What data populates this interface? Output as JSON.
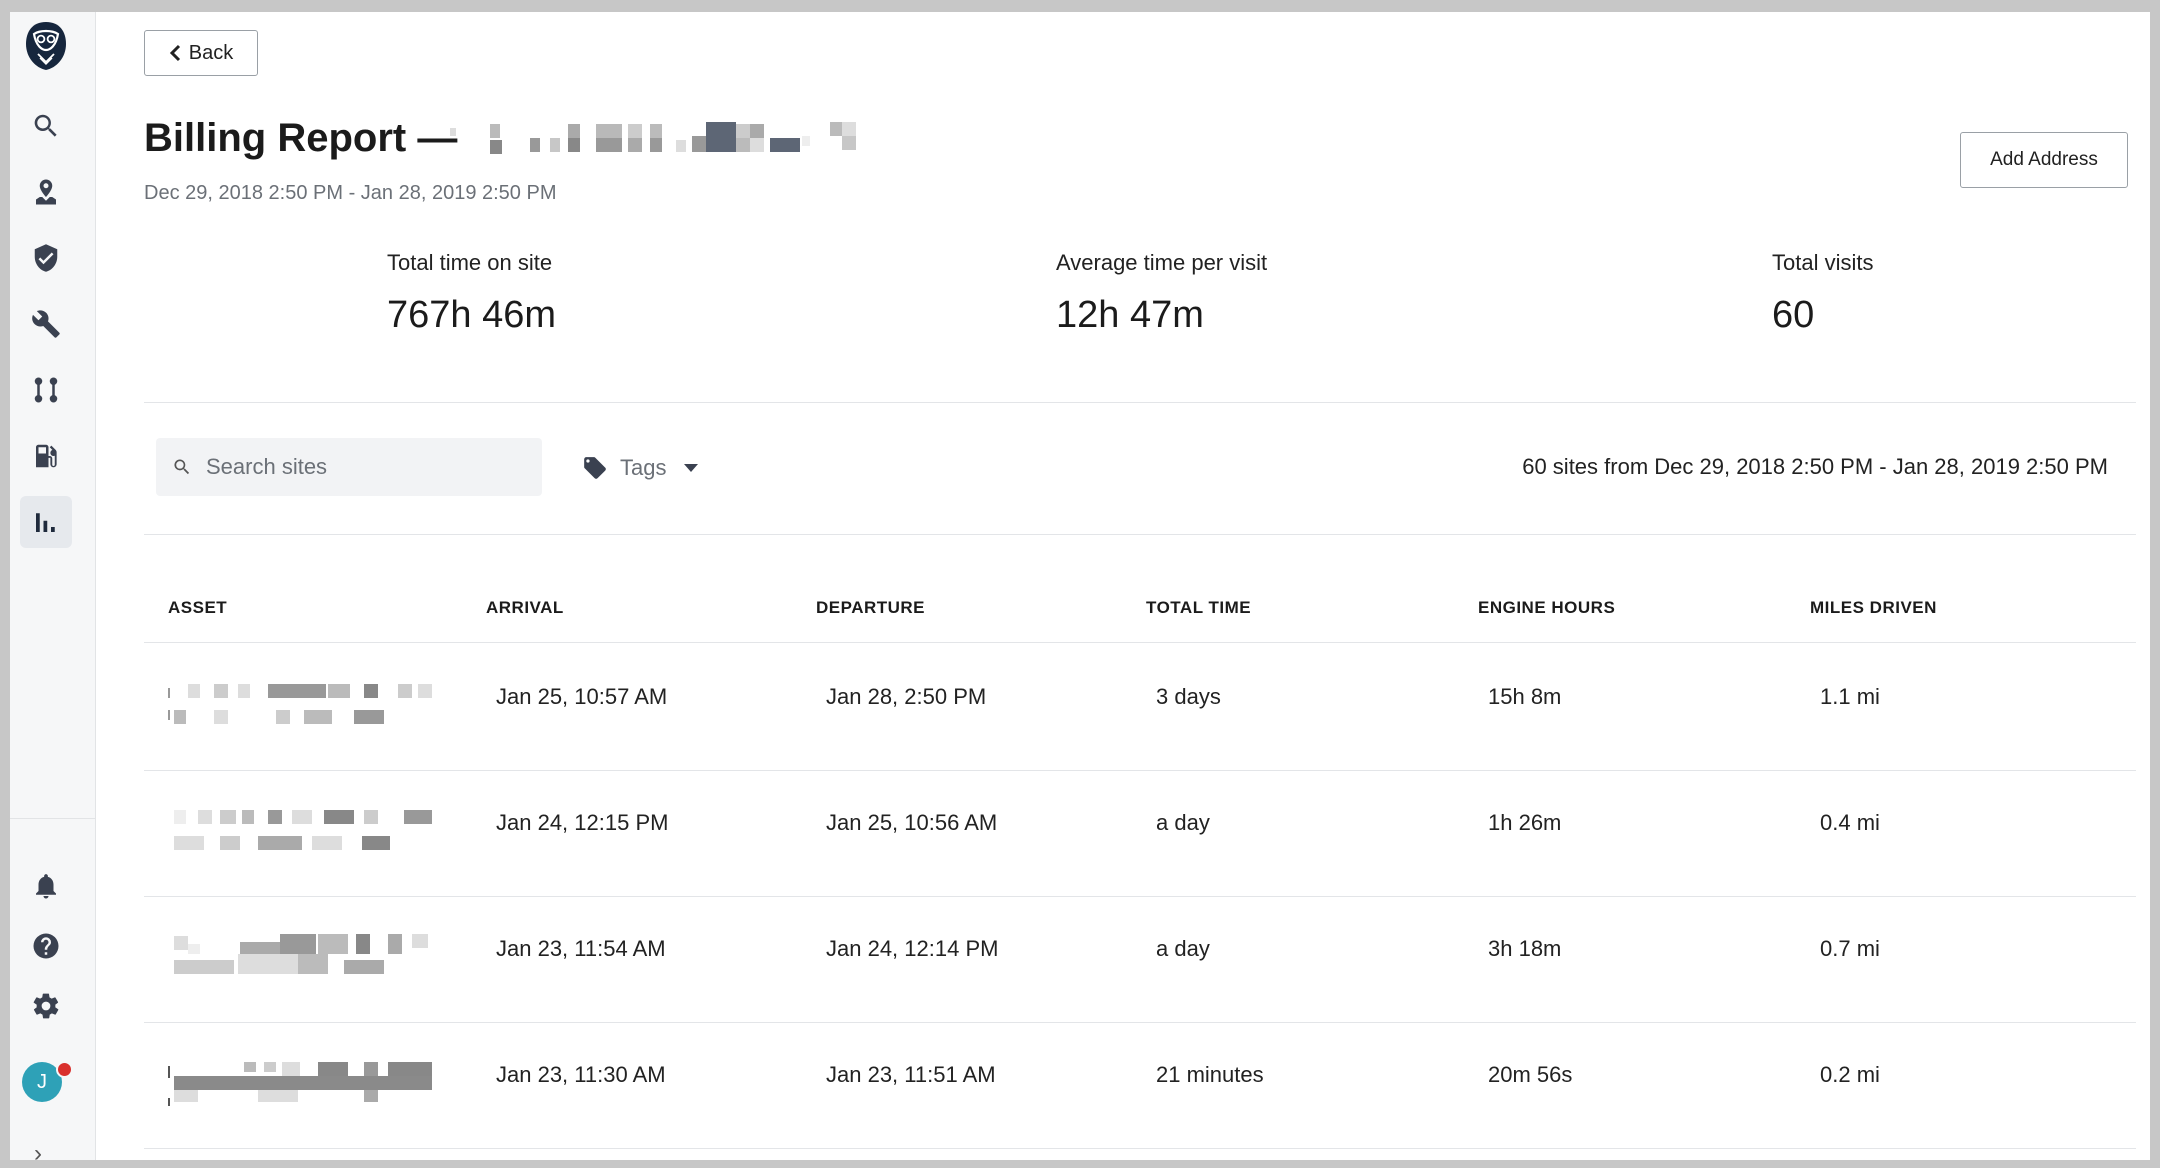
{
  "sidebar": {
    "items": [
      {
        "icon": "search-icon"
      },
      {
        "icon": "map-pin-icon"
      },
      {
        "icon": "shield-icon"
      },
      {
        "icon": "wrench-icon"
      },
      {
        "icon": "route-icon"
      },
      {
        "icon": "fuel-icon"
      },
      {
        "icon": "bar-chart-icon",
        "active": true
      }
    ],
    "bottom": [
      {
        "icon": "bell-icon"
      },
      {
        "icon": "help-icon"
      },
      {
        "icon": "gear-icon"
      }
    ],
    "avatar_initial": "J",
    "expand_glyph": "›"
  },
  "header": {
    "back_label": "Back",
    "title": "Billing Report —",
    "date_range": "Dec 29, 2018 2:50 PM - Jan 28, 2019 2:50 PM",
    "add_address_label": "Add Address"
  },
  "stats": [
    {
      "label": "Total time on site",
      "value": "767h 46m"
    },
    {
      "label": "Average time per visit",
      "value": "12h 47m"
    },
    {
      "label": "Total visits",
      "value": "60"
    }
  ],
  "filters": {
    "search_placeholder": "Search sites",
    "tags_label": "Tags",
    "summary": "60 sites from Dec 29, 2018 2:50 PM - Jan 28, 2019 2:50 PM"
  },
  "table": {
    "columns": [
      "ASSET",
      "ARRIVAL",
      "DEPARTURE",
      "TOTAL TIME",
      "ENGINE HOURS",
      "MILES DRIVEN"
    ],
    "rows": [
      {
        "arrival": "Jan 25, 10:57 AM",
        "departure": "Jan 28, 2:50 PM",
        "total_time": "3 days",
        "engine_hours": "15h 8m",
        "miles": "1.1 mi"
      },
      {
        "arrival": "Jan 24, 12:15 PM",
        "departure": "Jan 25, 10:56 AM",
        "total_time": "a day",
        "engine_hours": "1h 26m",
        "miles": "0.4 mi"
      },
      {
        "arrival": "Jan 23, 11:54 AM",
        "departure": "Jan 24, 12:14 PM",
        "total_time": "a day",
        "engine_hours": "3h 18m",
        "miles": "0.7 mi"
      },
      {
        "arrival": "Jan 23, 11:30 AM",
        "departure": "Jan 23, 11:51 AM",
        "total_time": "21 minutes",
        "engine_hours": "20m 56s",
        "miles": "0.2 mi"
      }
    ]
  }
}
